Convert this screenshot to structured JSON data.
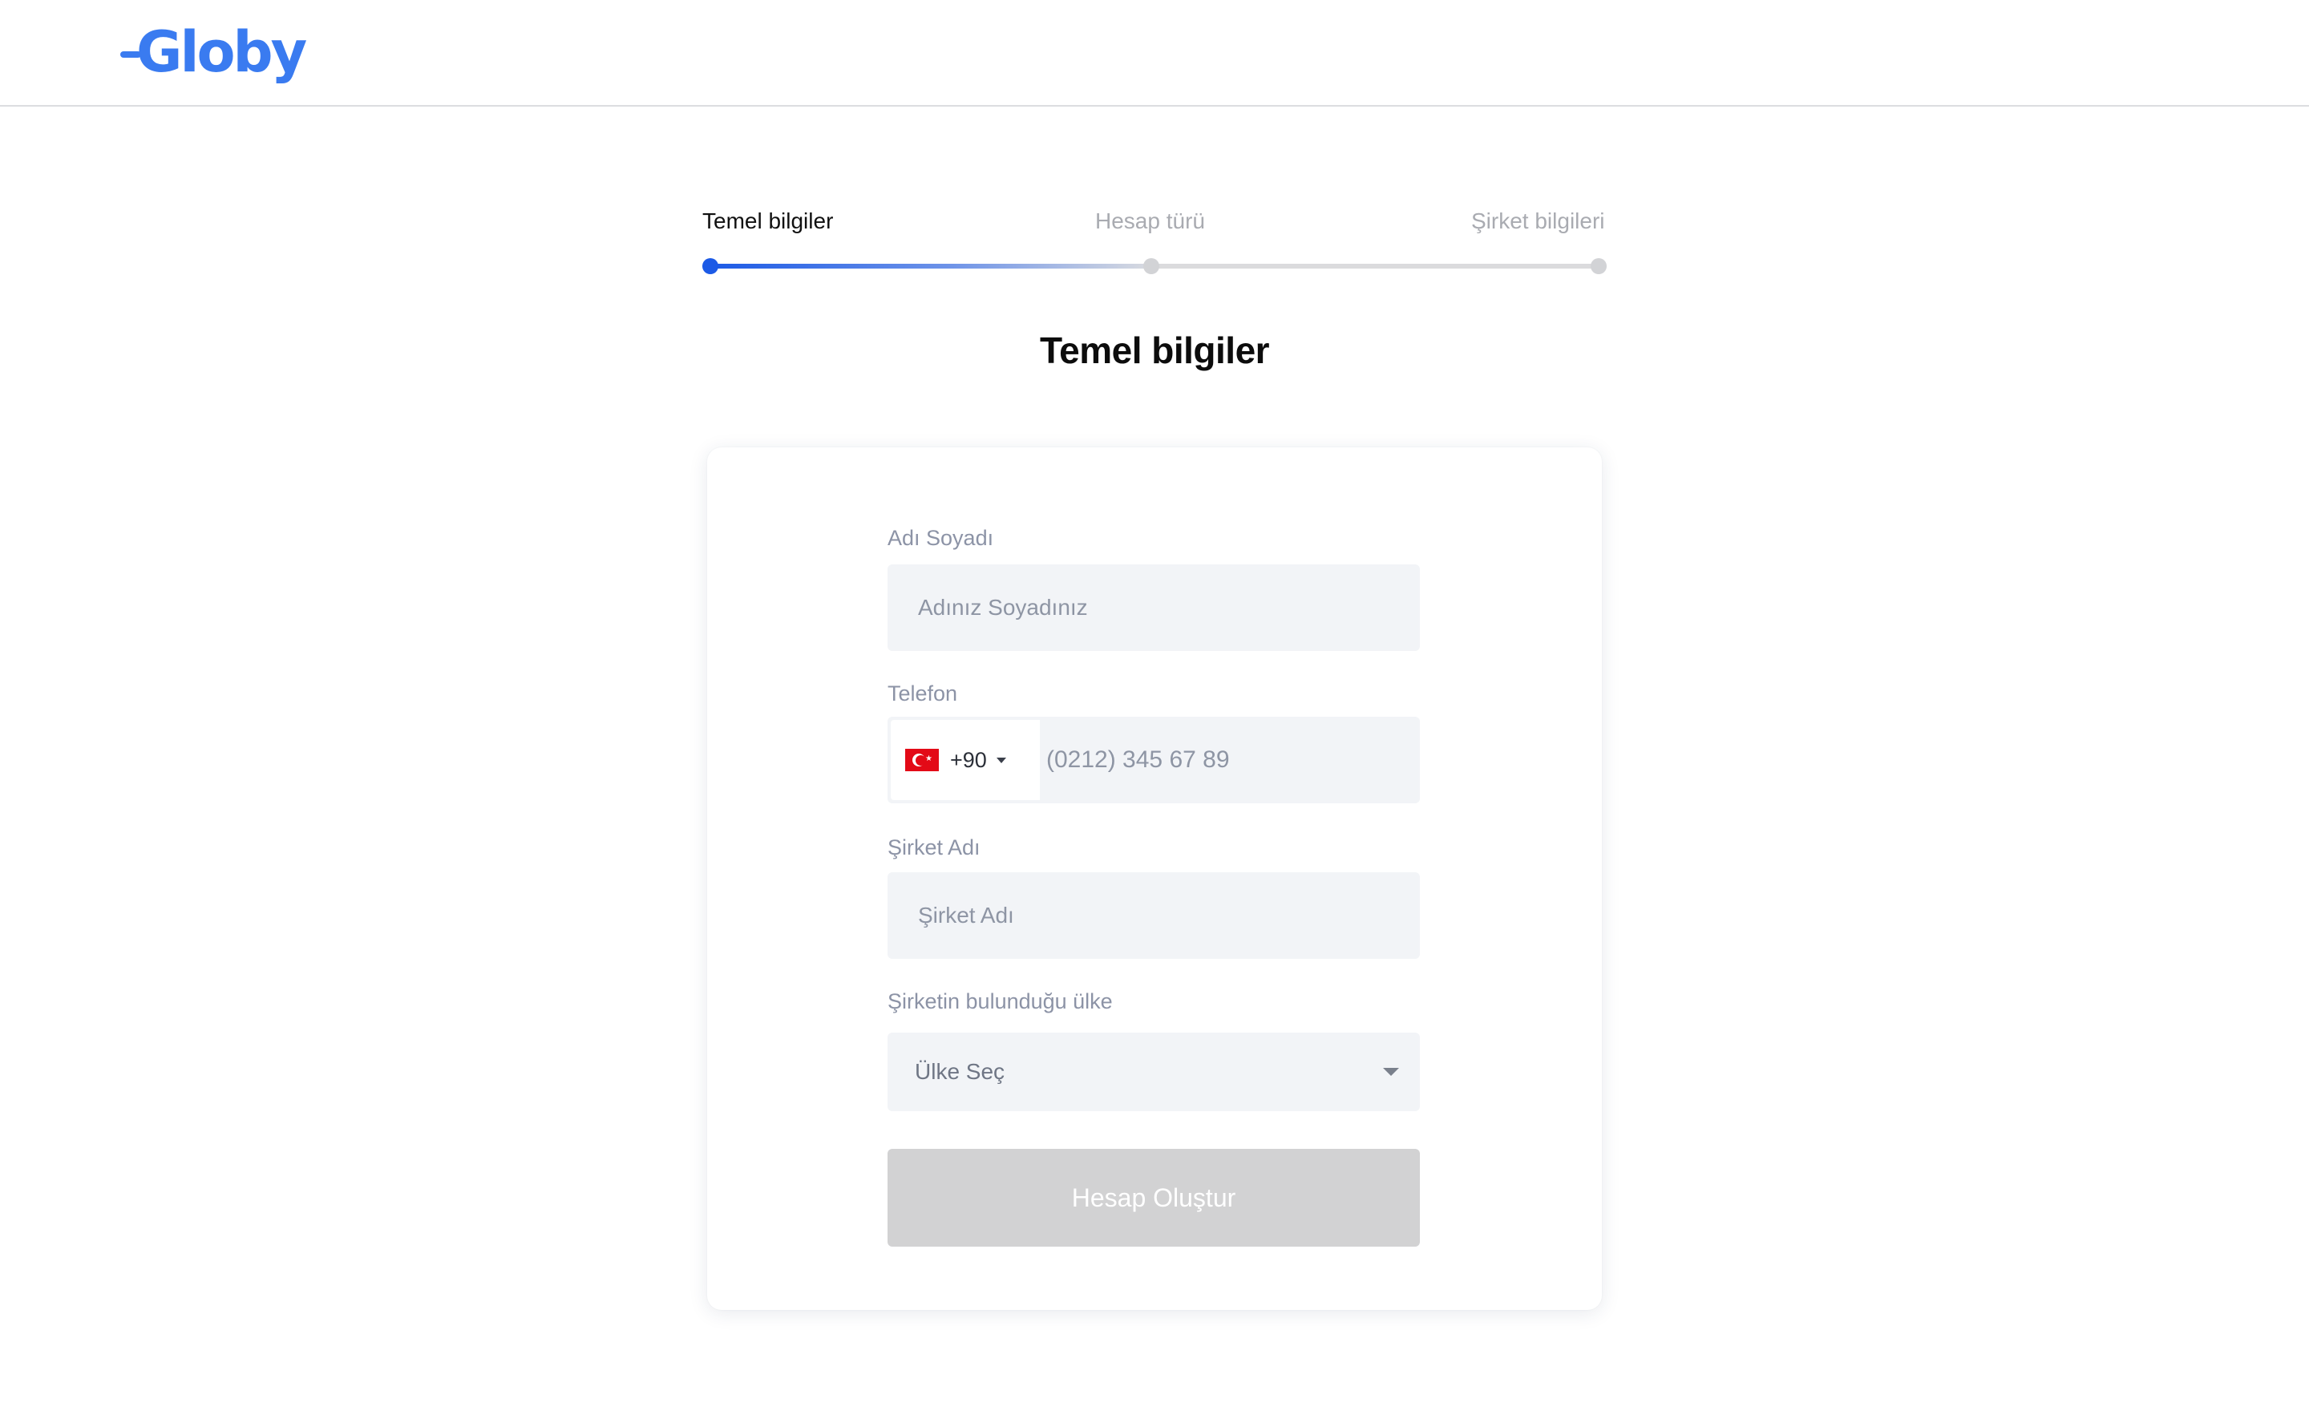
{
  "header": {
    "logo_text": "Globy"
  },
  "stepper": {
    "steps": [
      {
        "label": "Temel bilgiler",
        "state": "active"
      },
      {
        "label": "Hesap türü",
        "state": "inactive"
      },
      {
        "label": "Şirket bilgileri",
        "state": "inactive"
      }
    ],
    "active_color": "#1c5ae6",
    "inactive_color": "#d2d3d6"
  },
  "page": {
    "title": "Temel bilgiler"
  },
  "form": {
    "name": {
      "label": "Adı Soyadı",
      "placeholder": "Adınız Soyadınız"
    },
    "phone": {
      "label": "Telefon",
      "country_flag": "turkey-flag-icon",
      "dial_code": "+90",
      "placeholder": "(0212) 345 67 89"
    },
    "company": {
      "label": "Şirket Adı",
      "placeholder": "Şirket Adı"
    },
    "country": {
      "label": "Şirketin bulunduğu ülke",
      "selected": "Ülke Seç"
    },
    "submit_label": "Hesap Oluştur"
  },
  "colors": {
    "brand": "#3a7bf0",
    "button_disabled": "#d2d2d3",
    "input_bg": "#f2f4f7"
  }
}
